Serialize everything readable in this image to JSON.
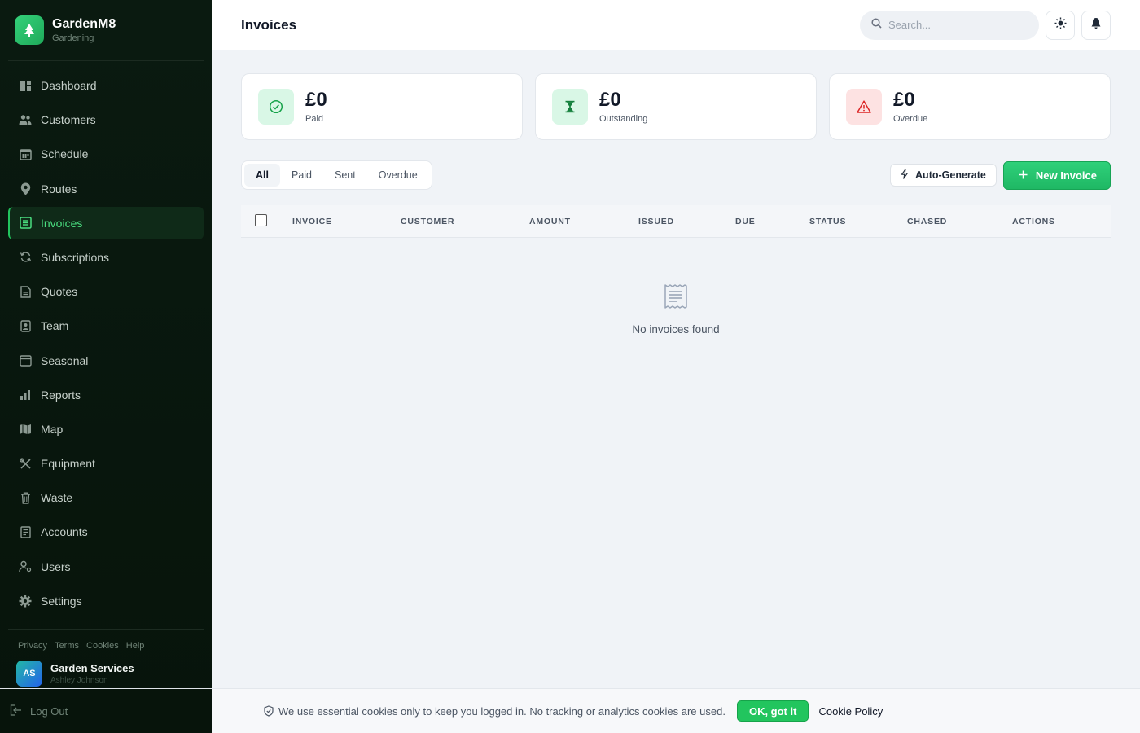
{
  "brand": {
    "name": "GardenM8",
    "subtitle": "Gardening"
  },
  "nav": [
    {
      "label": "Dashboard",
      "icon": "dashboard-icon",
      "active": false
    },
    {
      "label": "Customers",
      "icon": "users-icon",
      "active": false
    },
    {
      "label": "Schedule",
      "icon": "calendar-icon",
      "active": false
    },
    {
      "label": "Routes",
      "icon": "map-pin-icon",
      "active": false
    },
    {
      "label": "Invoices",
      "icon": "invoice-icon",
      "active": true
    },
    {
      "label": "Subscriptions",
      "icon": "refresh-icon",
      "active": false
    },
    {
      "label": "Quotes",
      "icon": "document-icon",
      "active": false
    },
    {
      "label": "Team",
      "icon": "badge-icon",
      "active": false
    },
    {
      "label": "Seasonal",
      "icon": "calendar-alt-icon",
      "active": false
    },
    {
      "label": "Reports",
      "icon": "bar-chart-icon",
      "active": false
    },
    {
      "label": "Map",
      "icon": "map-icon",
      "active": false
    },
    {
      "label": "Equipment",
      "icon": "tools-icon",
      "active": false
    },
    {
      "label": "Waste",
      "icon": "trash-icon",
      "active": false
    },
    {
      "label": "Accounts",
      "icon": "ledger-icon",
      "active": false
    },
    {
      "label": "Users",
      "icon": "user-gear-icon",
      "active": false
    },
    {
      "label": "Settings",
      "icon": "gear-icon",
      "active": false
    }
  ],
  "footer_links": [
    "Privacy",
    "Terms",
    "Cookies",
    "Help"
  ],
  "user": {
    "initials": "AS",
    "name": "Garden Services",
    "person": "Ashley Johnson"
  },
  "logout_label": "Log Out",
  "header": {
    "title": "Invoices",
    "search_placeholder": "Search..."
  },
  "stats": [
    {
      "value": "£0",
      "label": "Paid",
      "color": "#22c55e",
      "bg": "#d9f7e6",
      "icon": "check-circle-icon"
    },
    {
      "value": "£0",
      "label": "Outstanding",
      "color": "#16a34a",
      "bg": "#d9f7e6",
      "icon": "hourglass-icon"
    },
    {
      "value": "£0",
      "label": "Overdue",
      "color": "#ef4444",
      "bg": "#fde2e2",
      "icon": "warning-icon"
    }
  ],
  "tabs": [
    {
      "label": "All",
      "active": true
    },
    {
      "label": "Paid",
      "active": false
    },
    {
      "label": "Sent",
      "active": false
    },
    {
      "label": "Overdue",
      "active": false
    }
  ],
  "actions": {
    "auto_generate": "Auto-Generate",
    "new_invoice": "New Invoice"
  },
  "table": {
    "columns": [
      "INVOICE",
      "CUSTOMER",
      "AMOUNT",
      "ISSUED",
      "DUE",
      "STATUS",
      "CHASED",
      "ACTIONS"
    ],
    "rows": [],
    "empty_text": "No invoices found"
  },
  "cookie": {
    "text": "We use essential cookies only to keep you logged in. No tracking or analytics cookies are used.",
    "ok_label": "OK, got it",
    "policy_label": "Cookie Policy"
  },
  "colors": {
    "accent": "#22c55e",
    "sidebar_bg": "#07140b",
    "active_text": "#4ade80"
  }
}
